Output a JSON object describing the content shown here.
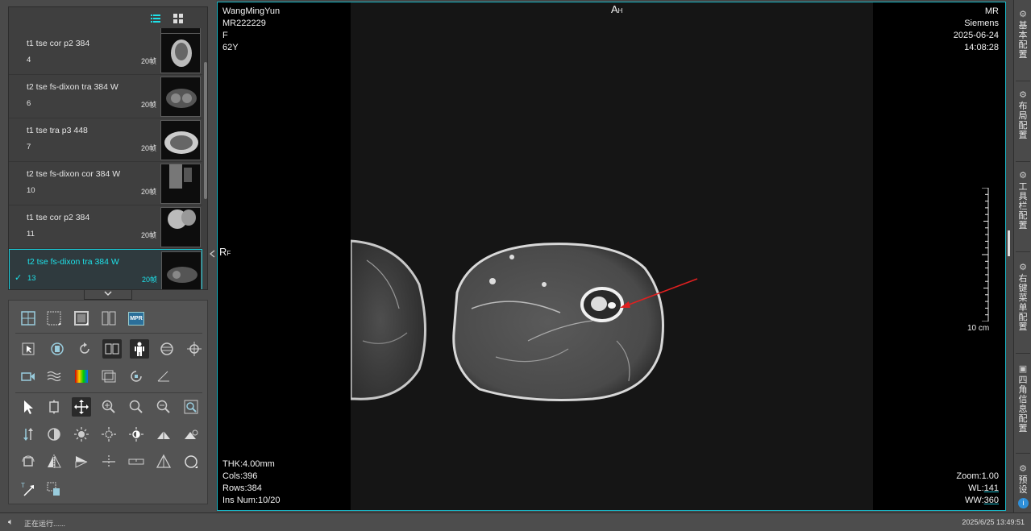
{
  "series_panel": {
    "view_icons": [
      "list-view-icon",
      "grid-view-icon"
    ],
    "items": [
      {
        "name": "t1 tse cor p2 384",
        "number": "4",
        "count": "20帧",
        "selected": false
      },
      {
        "name": "t2 tse fs-dixon tra 384 W",
        "number": "6",
        "count": "20帧",
        "selected": false
      },
      {
        "name": "t1 tse tra p3 448",
        "number": "7",
        "count": "20帧",
        "selected": false
      },
      {
        "name": "t2 tse fs-dixon cor 384 W",
        "number": "10",
        "count": "20帧",
        "selected": false
      },
      {
        "name": "t1 tse cor p2 384",
        "number": "11",
        "count": "20帧",
        "selected": false
      },
      {
        "name": "t2 tse fs-dixon tra 384 W",
        "number": "13",
        "count": "20帧",
        "selected": true
      }
    ],
    "check_mark": "✓"
  },
  "toolbar": {
    "mpr_label": "MPR",
    "text_tool_label": "T"
  },
  "viewport": {
    "top_left": {
      "patient_name": "WangMingYun",
      "patient_id": "MR222229",
      "sex": "F",
      "age": "62Y"
    },
    "top_right": {
      "modality": "MR",
      "manufacturer": "Siemens",
      "date": "2025-06-24",
      "time": "14:08:28"
    },
    "orient_top": {
      "main": "A",
      "sub": "H"
    },
    "orient_left": {
      "main": "R",
      "sub": "F"
    },
    "bottom_left": {
      "thk": "THK:4.00mm",
      "cols": "Cols:396",
      "rows": "Rows:384",
      "ins": "Ins Num:10/20"
    },
    "bottom_right": {
      "zoom": "Zoom:1.00",
      "wl_label": "WL:",
      "wl_value": "141",
      "ww_label": "WW:",
      "ww_value": "360"
    },
    "scale_label": "10 cm"
  },
  "right_sidebar": {
    "tabs": [
      "基本配置",
      "布局配置",
      "工具栏配置",
      "右键菜单配置",
      "四角信息配置",
      "预设"
    ]
  },
  "status_bar": {
    "text": "正在运行......",
    "datetime": "2025/6/25  13:49:51"
  }
}
